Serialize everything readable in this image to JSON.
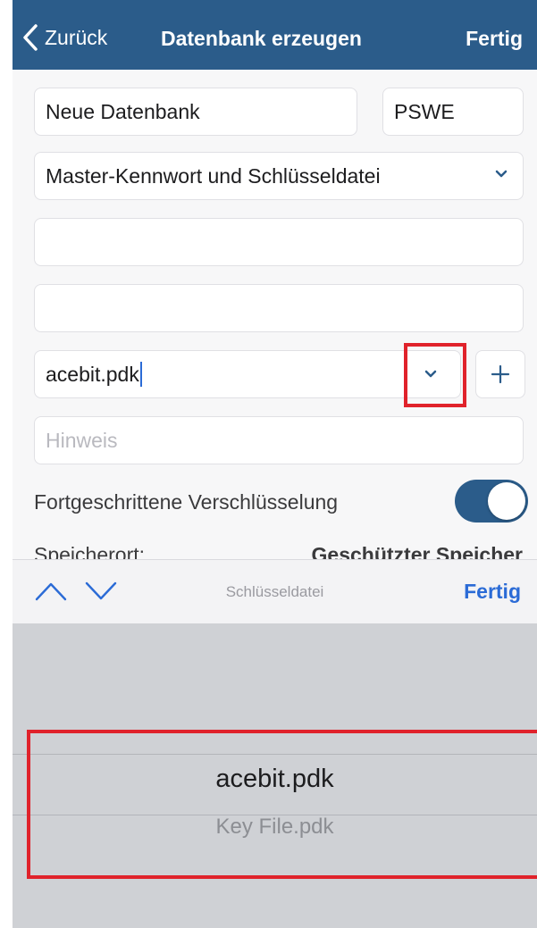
{
  "navbar": {
    "back_label": "Zurück",
    "title": "Datenbank erzeugen",
    "done_label": "Fertig",
    "background": "#2b5c8a"
  },
  "form": {
    "database_name": "Neue Datenbank",
    "database_short": "PSWE",
    "protection_mode": "Master-Kennwort und Schlüsseldatei",
    "password_value": "",
    "password_repeat_value": "",
    "keyfile_value": "acebit.pdk",
    "hint_placeholder": "Hinweis",
    "advanced_encryption_label": "Fortgeschrittene Verschlüsselung",
    "advanced_encryption_enabled": true,
    "storage_label": "Speicherort:",
    "storage_value": "Geschützter Speicher"
  },
  "toolbar": {
    "title": "Schlüsseldatei",
    "done_label": "Fertig",
    "accent": "#2b6bd6"
  },
  "picker": {
    "options": [
      "acebit.pdk",
      "Key File.pdk"
    ],
    "selected": "acebit.pdk"
  },
  "annotation_color": "#e0222b"
}
